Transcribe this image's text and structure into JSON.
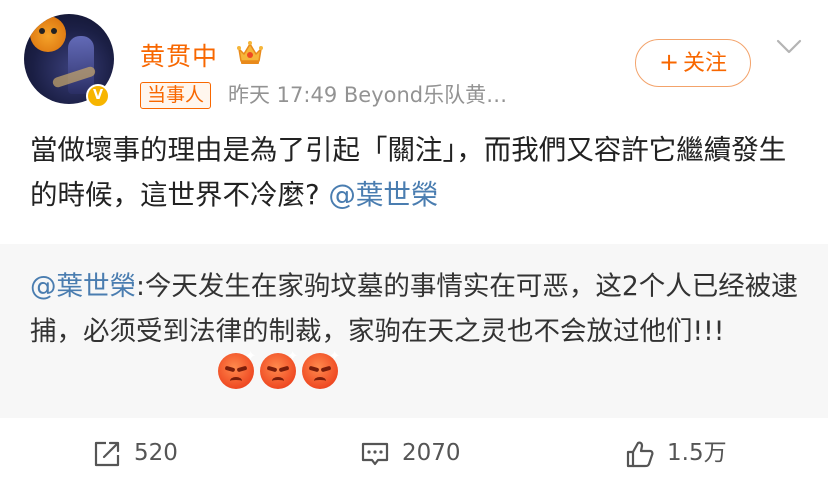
{
  "header": {
    "username": "黄贯中",
    "tag": "当事人",
    "meta": "昨天 17:49  Beyond乐队黄…",
    "follow_label": "关注",
    "verified_mark": "V"
  },
  "post": {
    "text_main": "當做壞事的理由是為了引起「關注」，而我們又容許它繼續發生的時候，這世界不冷麼? ",
    "mention": "@葉世榮"
  },
  "repost": {
    "mention": "@葉世榮",
    "text": ":今天发生在家驹坟墓的事情实在可恶，这2个人已经被逮捕，必须受到法律的制裁，家驹在天之灵也不会放过他们!!! ",
    "emojis": [
      "angry-emoji",
      "angry-emoji",
      "angry-emoji"
    ]
  },
  "footer": {
    "repost_count": "520",
    "comment_count": "2070",
    "like_count": "1.5万"
  },
  "colors": {
    "name_orange": "#f86700",
    "mention_blue": "#4a7db0",
    "meta_gray": "#939393",
    "repost_bg": "#f7f7f7"
  }
}
